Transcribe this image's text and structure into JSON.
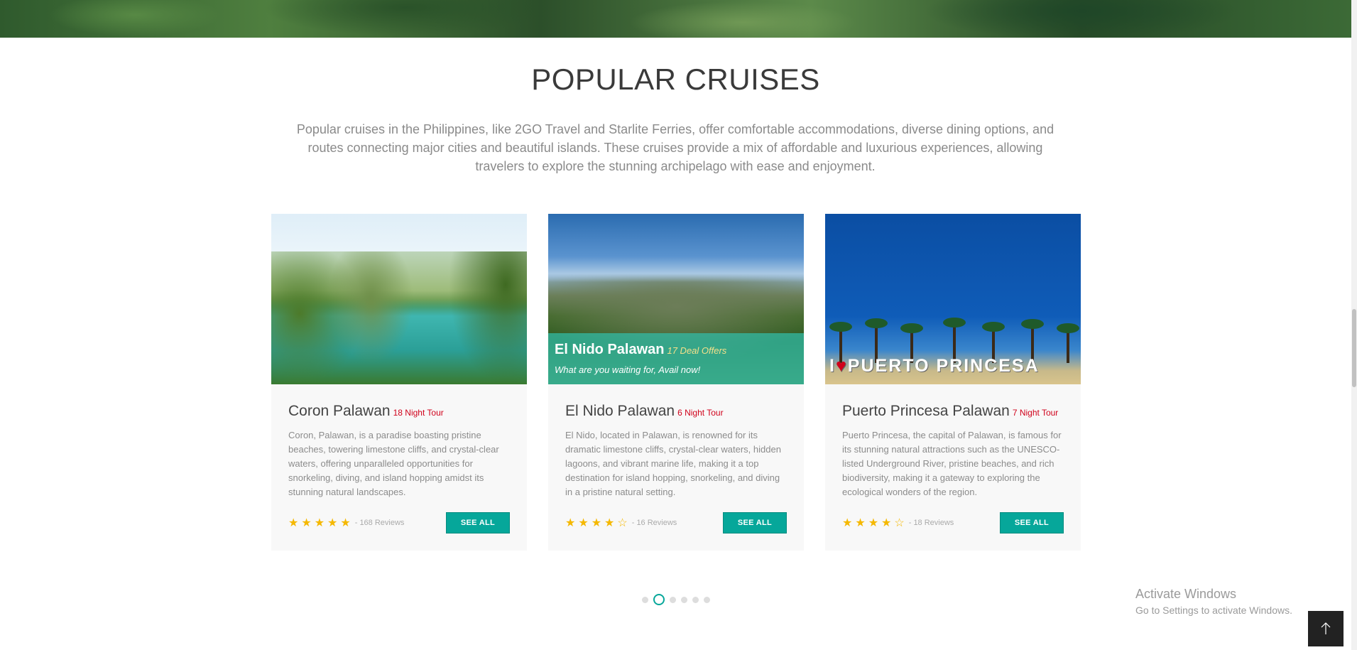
{
  "section": {
    "title": "POPULAR CRUISES",
    "intro": "Popular cruises in the Philippines, like 2GO Travel and Starlite Ferries, offer comfortable accommodations, diverse dining options, and routes connecting major cities and beautiful islands. These cruises provide a mix of affordable and luxurious experiences, allowing travelers to explore the stunning archipelago with ease and enjoyment."
  },
  "cards": [
    {
      "name": "Coron Palawan",
      "tag": "18 Night Tour",
      "desc": "Coron, Palawan, is a paradise boasting pristine beaches, towering limestone cliffs, and crystal-clear waters, offering unparalleled opportunities for snorkeling, diving, and island hopping amidst its stunning natural landscapes.",
      "rating": 5,
      "reviews": "- 168 Reviews",
      "button": "SEE ALL"
    },
    {
      "name": "El Nido Palawan",
      "tag": "6 Night Tour",
      "desc": "El Nido, located in Palawan, is renowned for its dramatic limestone cliffs, crystal-clear waters, hidden lagoons, and vibrant marine life, making it a top destination for island hopping, snorkeling, and diving in a pristine natural setting.",
      "rating": 4,
      "reviews": "- 16 Reviews",
      "button": "SEE ALL",
      "overlay": {
        "title": "El Nido Palawan",
        "offers": "17 Deal Offers",
        "subtitle": "What are you waiting for, Avail now!"
      }
    },
    {
      "name": "Puerto Princesa Palawan",
      "tag": "7 Night Tour",
      "desc": "Puerto Princesa, the capital of Palawan, is famous for its stunning natural attractions such as the UNESCO-listed Underground River, pristine beaches, and rich biodiversity, making it a gateway to exploring the ecological wonders of the region.",
      "rating": 4,
      "reviews": "- 18 Reviews",
      "button": "SEE ALL",
      "sign": "PUERTO PRINCESA"
    }
  ],
  "carousel": {
    "count": 6,
    "active_index": 1
  },
  "windows_notice": {
    "line1": "Activate Windows",
    "line2": "Go to Settings to activate Windows."
  },
  "icons": {
    "star": "star-icon",
    "star_outline": "star-outline-icon",
    "back_to_top": "arrow-up-icon"
  },
  "colors": {
    "accent": "#06a79a",
    "tag": "#d0021b",
    "star": "#f5b800"
  }
}
